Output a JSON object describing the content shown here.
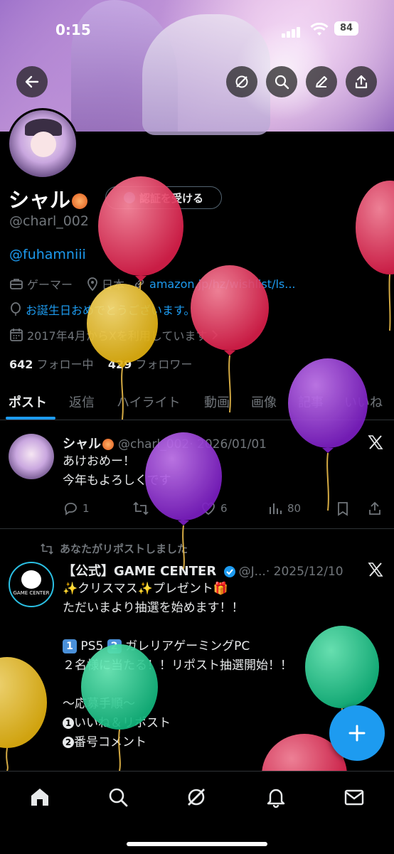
{
  "status_bar": {
    "time": "0:15",
    "battery": "84"
  },
  "profile": {
    "display_name": "シャル",
    "verify_button_label": "認証を受ける",
    "handle": "@charl_002",
    "bio": "@fuhamniii",
    "category": "ゲーマー",
    "location": "日本",
    "website": "amazon.jp/hz/wishlist/ls...",
    "birthday": "お誕生日おめでとうございます。",
    "joined": "2017年4月からXを利用しています",
    "following_count": "642",
    "following_label": "フォロー中",
    "followers_count": "429",
    "followers_label": "フォロワー"
  },
  "tabs": [
    {
      "label": "ポスト",
      "active": true
    },
    {
      "label": "返信"
    },
    {
      "label": "ハイライト"
    },
    {
      "label": "動画"
    },
    {
      "label": "画像"
    },
    {
      "label": "記事"
    },
    {
      "label": "いいね"
    }
  ],
  "posts": [
    {
      "author": "シャル",
      "handle": "@charl_002",
      "date": "· 2026/01/01",
      "lines": [
        "あけおめー！",
        "今年もよろしくです"
      ],
      "replies": "1",
      "likes": "6",
      "views": "80"
    },
    {
      "repost_notice": "あなたがリポストしました",
      "author": "【公式】GAME CENTER",
      "handle": "@J...",
      "date": "· 2025/12/10",
      "line1": "✨クリスマス✨プレゼント🎁",
      "line2": "ただいまより抽選を始めます！！",
      "item1_key": "1",
      "item1": "PS5",
      "item2_key": "2",
      "item2": "ガレリアゲーミングPC",
      "line4": "２名様に当たる！！リポスト抽選開始！！",
      "line5": "〜応募手順〜",
      "step1_num": "1",
      "step1": "いいね＆リポスト",
      "step2_num": "2",
      "step2": "番号コメント",
      "avatar_text": "GAME CENTER"
    }
  ],
  "colors": {
    "accent": "#1d9bf0",
    "background": "#000000",
    "text": "#e7e9ea",
    "muted": "#71767b"
  }
}
